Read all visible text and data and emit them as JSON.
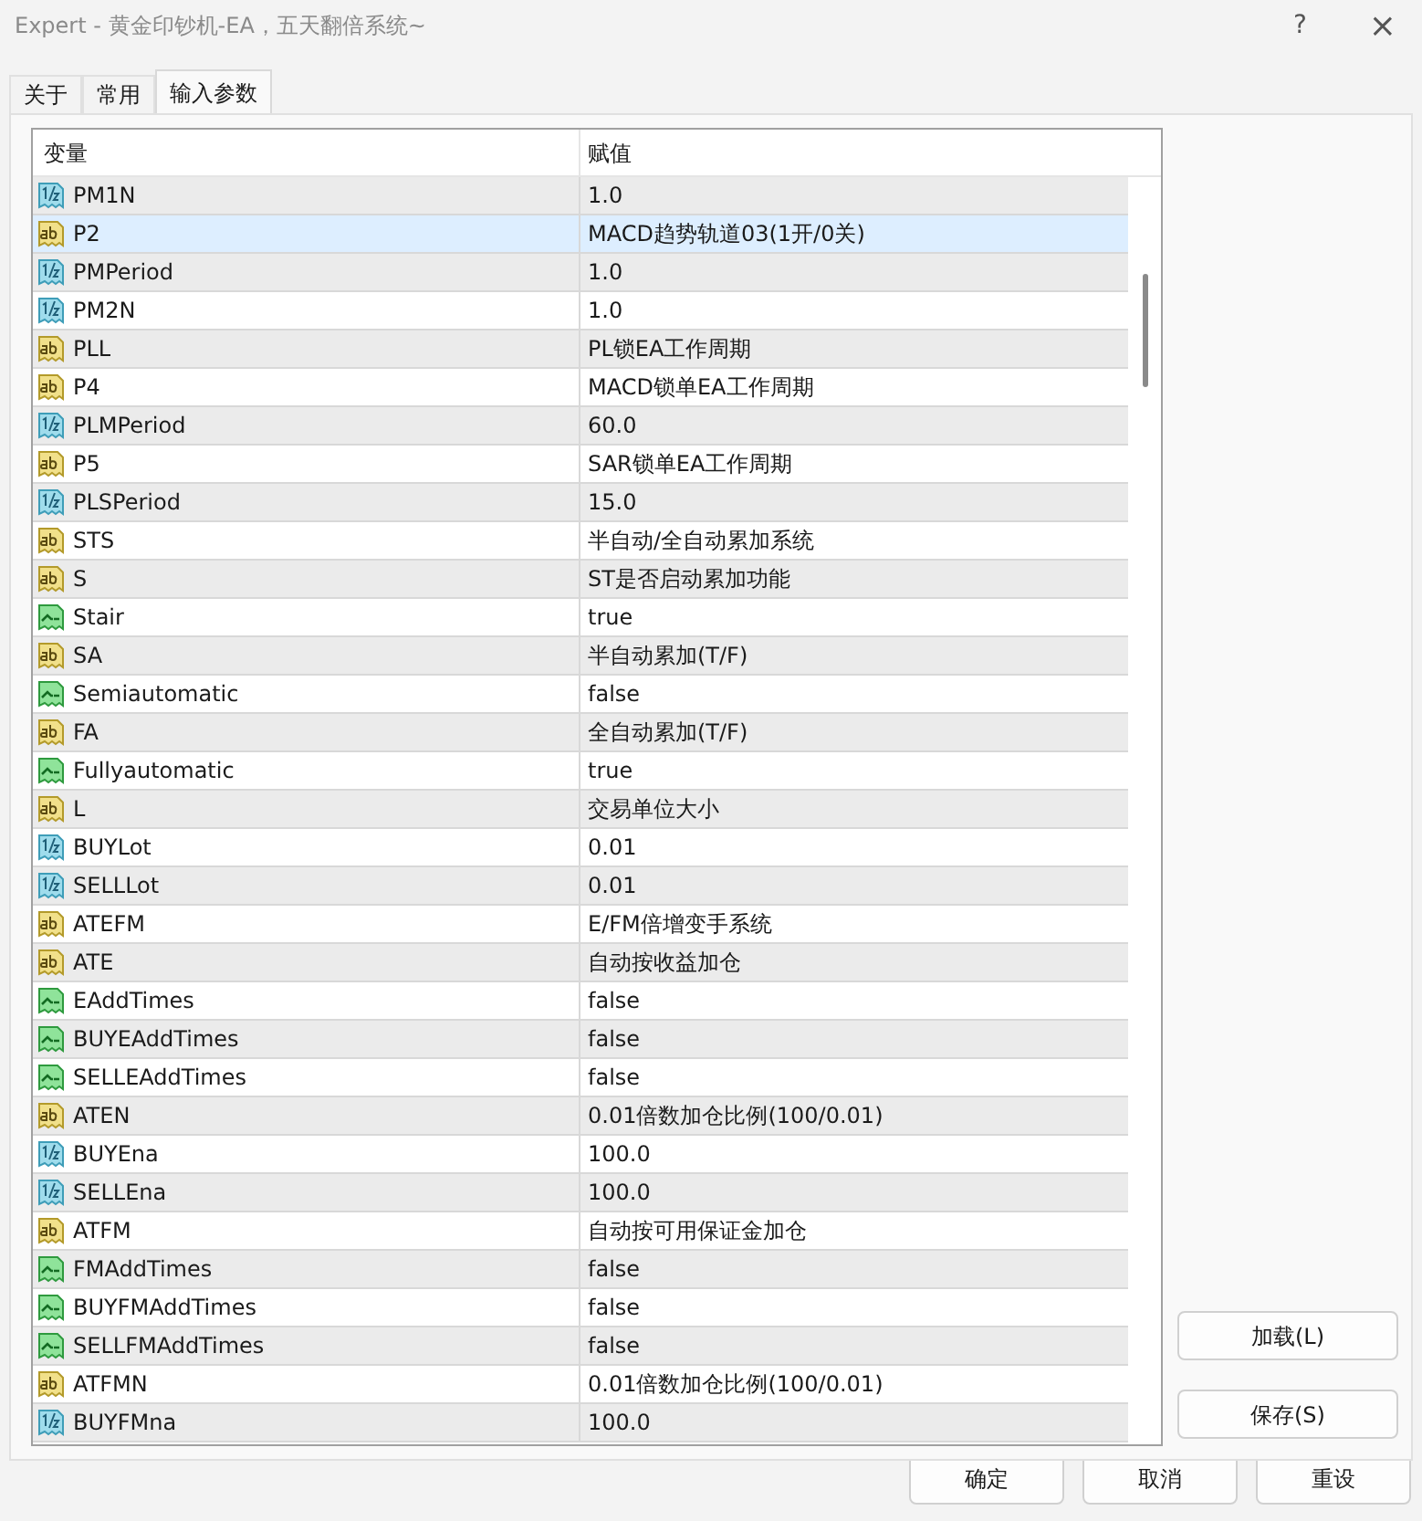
{
  "window": {
    "title": "Expert - 黄金印钞机-EA，五天翻倍系统~",
    "help": "?",
    "close": "×"
  },
  "tabs": [
    {
      "label": "关于",
      "selected": false
    },
    {
      "label": "常用",
      "selected": false
    },
    {
      "label": "输入参数",
      "selected": true
    }
  ],
  "table": {
    "columns": [
      "变量",
      "赋值"
    ],
    "rows": [
      {
        "kind": "double",
        "name": "PM1N",
        "value": "1.0",
        "selected": false
      },
      {
        "kind": "string",
        "name": "P2",
        "value": "MACD趋势轨道03(1开/0关)",
        "selected": true
      },
      {
        "kind": "double",
        "name": "PMPeriod",
        "value": "1.0",
        "selected": false
      },
      {
        "kind": "double",
        "name": "PM2N",
        "value": "1.0",
        "selected": false
      },
      {
        "kind": "string",
        "name": "PLL",
        "value": "PL锁EA工作周期",
        "selected": false
      },
      {
        "kind": "string",
        "name": "P4",
        "value": "MACD锁单EA工作周期",
        "selected": false
      },
      {
        "kind": "double",
        "name": "PLMPeriod",
        "value": "60.0",
        "selected": false
      },
      {
        "kind": "string",
        "name": "P5",
        "value": "SAR锁单EA工作周期",
        "selected": false
      },
      {
        "kind": "double",
        "name": "PLSPeriod",
        "value": "15.0",
        "selected": false
      },
      {
        "kind": "string",
        "name": "STS",
        "value": "半自动/全自动累加系统",
        "selected": false
      },
      {
        "kind": "string",
        "name": "S",
        "value": "ST是否启动累加功能",
        "selected": false
      },
      {
        "kind": "bool",
        "name": "Stair",
        "value": "true",
        "selected": false
      },
      {
        "kind": "string",
        "name": "SA",
        "value": "半自动累加(T/F)",
        "selected": false
      },
      {
        "kind": "bool",
        "name": "Semiautomatic",
        "value": "false",
        "selected": false
      },
      {
        "kind": "string",
        "name": "FA",
        "value": "全自动累加(T/F)",
        "selected": false
      },
      {
        "kind": "bool",
        "name": "Fullyautomatic",
        "value": "true",
        "selected": false
      },
      {
        "kind": "string",
        "name": "L",
        "value": "交易单位大小",
        "selected": false
      },
      {
        "kind": "double",
        "name": "BUYLot",
        "value": "0.01",
        "selected": false
      },
      {
        "kind": "double",
        "name": "SELLLot",
        "value": "0.01",
        "selected": false
      },
      {
        "kind": "string",
        "name": "ATEFM",
        "value": "E/FM倍增变手系统",
        "selected": false
      },
      {
        "kind": "string",
        "name": "ATE",
        "value": "自动按收益加仓",
        "selected": false
      },
      {
        "kind": "bool",
        "name": "EAddTimes",
        "value": "false",
        "selected": false
      },
      {
        "kind": "bool",
        "name": "BUYEAddTimes",
        "value": "false",
        "selected": false
      },
      {
        "kind": "bool",
        "name": "SELLEAddTimes",
        "value": "false",
        "selected": false
      },
      {
        "kind": "string",
        "name": "ATEN",
        "value": "0.01倍数加仓比例(100/0.01)",
        "selected": false
      },
      {
        "kind": "double",
        "name": "BUYEna",
        "value": "100.0",
        "selected": false
      },
      {
        "kind": "double",
        "name": "SELLEna",
        "value": "100.0",
        "selected": false
      },
      {
        "kind": "string",
        "name": "ATFM",
        "value": "自动按可用保证金加仓",
        "selected": false
      },
      {
        "kind": "bool",
        "name": "FMAddTimes",
        "value": "false",
        "selected": false
      },
      {
        "kind": "bool",
        "name": "BUYFMAddTimes",
        "value": "false",
        "selected": false
      },
      {
        "kind": "bool",
        "name": "SELLFMAddTimes",
        "value": "false",
        "selected": false
      },
      {
        "kind": "string",
        "name": "ATFMN",
        "value": "0.01倍数加仓比例(100/0.01)",
        "selected": false
      },
      {
        "kind": "double",
        "name": "BUYFMna",
        "value": "100.0",
        "selected": false
      }
    ]
  },
  "side_buttons": [
    "加载(L)",
    "保存(S)"
  ],
  "buttons": [
    "确定",
    "取消",
    "重设"
  ]
}
